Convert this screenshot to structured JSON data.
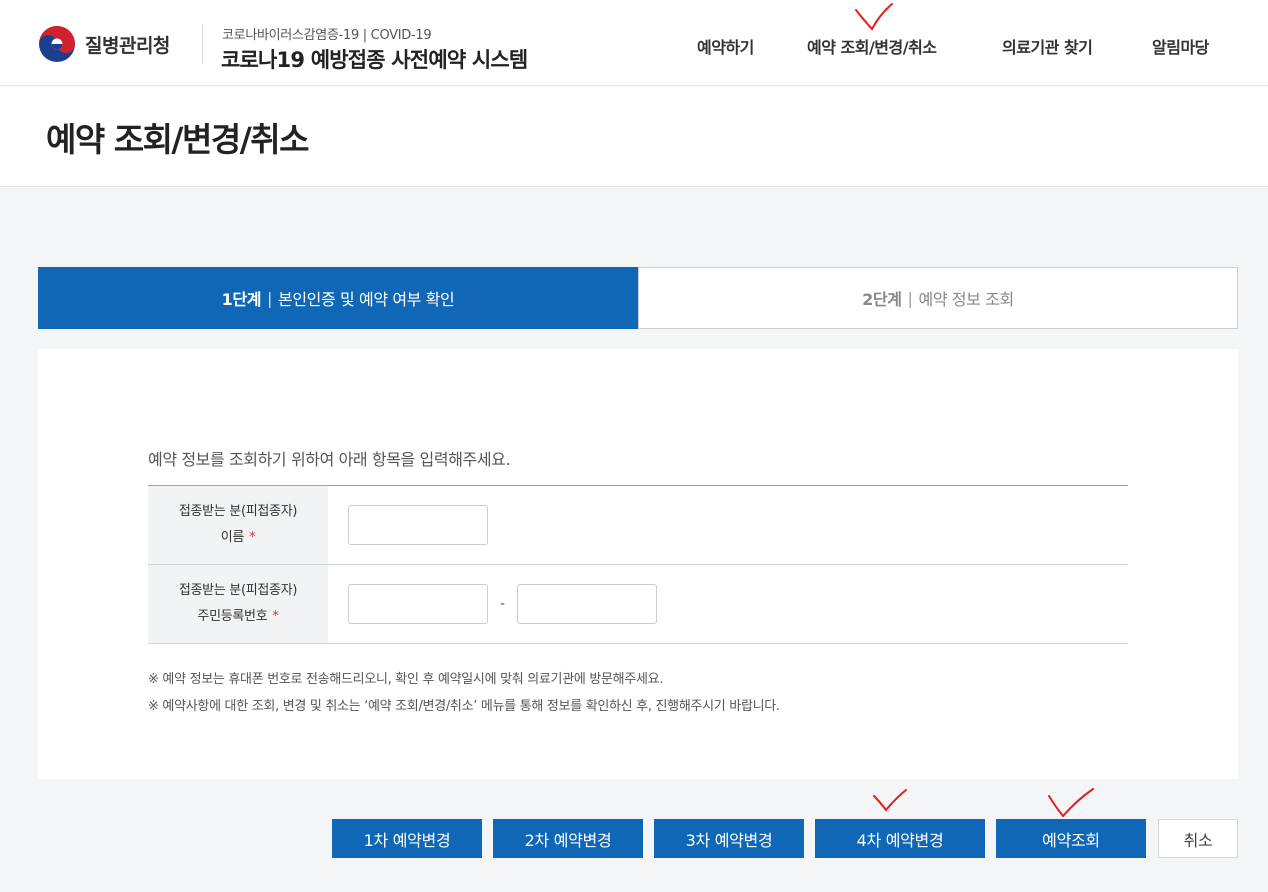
{
  "header": {
    "agency_name": "질병관리청",
    "system_subtitle": "코로나바이러스감염증-19 | COVID-19",
    "system_title": "코로나19 예방접종 사전예약 시스템",
    "nav": [
      {
        "label": "예약하기"
      },
      {
        "label": "예약 조회/변경/취소"
      },
      {
        "label": "의료기관 찾기"
      },
      {
        "label": "알림마당"
      }
    ]
  },
  "page_title": "예약 조회/변경/취소",
  "steps": [
    {
      "num": "1단계",
      "sep": "|",
      "label": "본인인증 및 예약 여부 확인",
      "active": true
    },
    {
      "num": "2단계",
      "sep": "|",
      "label": "예약 정보 조회",
      "active": false
    }
  ],
  "form": {
    "intro": "예약 정보를 조회하기 위하여 아래 항목을 입력해주세요.",
    "name_label_1": "접종받는 분(피접종자)",
    "name_label_2": "이름",
    "rrn_label_1": "접종받는 분(피접종자)",
    "rrn_label_2": "주민등록번호",
    "required_mark": "*",
    "rrn_separator": "-",
    "name_value": "",
    "rrn_front_value": "",
    "rrn_back_value": ""
  },
  "notes": [
    "※ 예약 정보는 휴대폰 번호로 전송해드리오니, 확인 후 예약일시에 맞춰 의료기관에 방문해주세요.",
    "※ 예약사항에 대한 조회, 변경 및 취소는 ‘예약 조회/변경/취소’ 메뉴를 통해 정보를 확인하신 후, 진행해주시기 바랍니다."
  ],
  "buttons": {
    "change_1": "1차 예약변경",
    "change_2": "2차 예약변경",
    "change_3": "3차 예약변경",
    "change_4": "4차 예약변경",
    "lookup": "예약조회",
    "cancel": "취소"
  },
  "colors": {
    "primary": "#0f67b5",
    "annotation_red": "#e0201c",
    "required": "#d6322e"
  }
}
